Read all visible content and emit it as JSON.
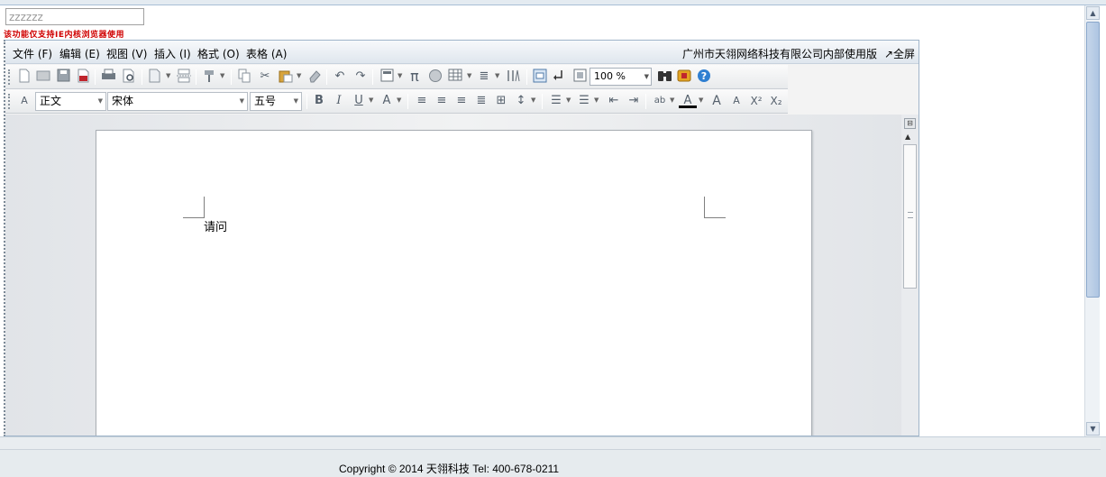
{
  "title_field": {
    "value": "zzzzzz"
  },
  "warning_text": "该功能仅支持IE内核浏览器使用",
  "menu": {
    "items": [
      {
        "label": "文件 (F)"
      },
      {
        "label": "编辑 (E)"
      },
      {
        "label": "视图 (V)"
      },
      {
        "label": "插入 (I)"
      },
      {
        "label": "格式 (O)"
      },
      {
        "label": "表格 (A)"
      }
    ],
    "company": "广州市天翎网络科技有限公司内部使用版",
    "fullscreen": "↗全屏"
  },
  "toolbar1": {
    "zoom": "100 %",
    "icons": [
      "new-doc-icon",
      "open-icon",
      "save-icon",
      "pdf-icon",
      "print-icon",
      "print-preview-icon",
      "insert-icon",
      "page-break-icon",
      "format-brush-icon",
      "copy-icon",
      "cut-icon",
      "paste-icon",
      "eraser-icon",
      "undo-icon",
      "redo-icon",
      "field-icon",
      "pi-icon",
      "image-icon",
      "table-icon",
      "columns-icon",
      "text-direction-icon",
      "review-icon",
      "track-icon",
      "page-view-icon",
      "find-icon",
      "box-icon",
      "help-icon"
    ]
  },
  "toolbar2": {
    "style": "正文",
    "font": "宋体",
    "size": "五号",
    "bold": "B",
    "italic": "I",
    "underline": "U",
    "grow": "A",
    "superscript": "X²",
    "subscript": "X₂"
  },
  "document": {
    "text": "请问"
  },
  "footer": {
    "copyright": "Copyright © 2014 天翎科技  Tel: 400-678-0211"
  },
  "colors": {
    "accent": "#a9bfd6",
    "warning": "#d00000",
    "help": "#2f7fd1"
  }
}
